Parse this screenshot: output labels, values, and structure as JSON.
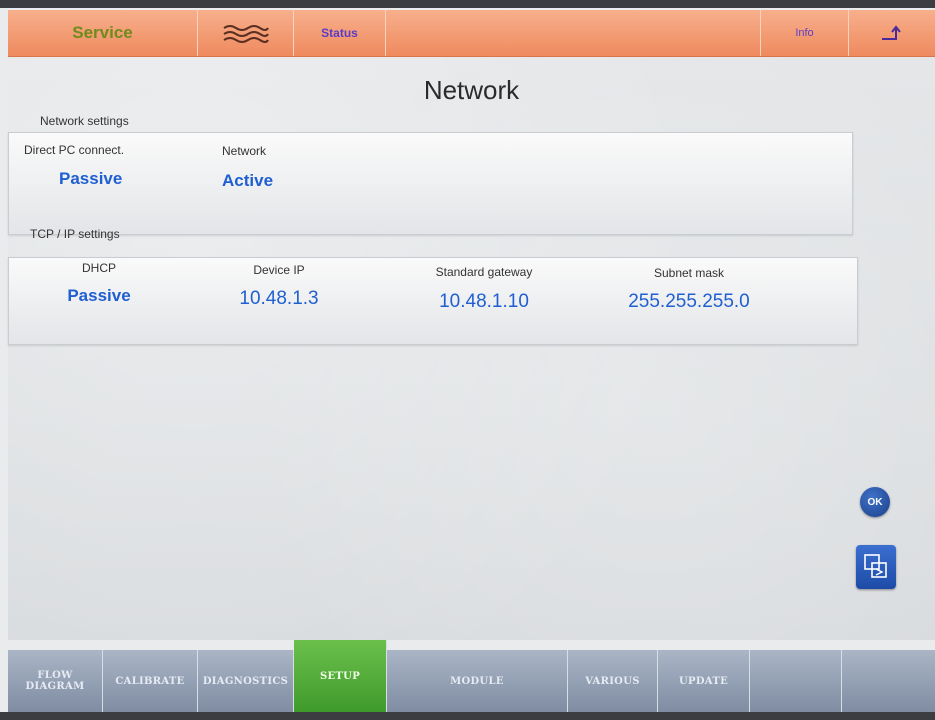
{
  "topbar": {
    "service": "Service",
    "status": "Status",
    "info": "Info"
  },
  "page": {
    "title": "Network"
  },
  "network_settings": {
    "label": "Network settings",
    "direct_pc": {
      "header": "Direct PC connect.",
      "value": "Passive"
    },
    "network": {
      "header": "Network",
      "value": "Active"
    }
  },
  "tcp_ip": {
    "label": "TCP / IP settings",
    "dhcp": {
      "header": "DHCP",
      "value": "Passive"
    },
    "device_ip": {
      "header": "Device IP",
      "value": "10.48.1.3"
    },
    "gateway": {
      "header": "Standard gateway",
      "value": "10.48.1.10"
    },
    "subnet": {
      "header": "Subnet mask",
      "value": "255.255.255.0"
    }
  },
  "buttons": {
    "ok": "OK"
  },
  "bottom_tabs": [
    {
      "label": "FLOW DIAGRAM"
    },
    {
      "label": "CALIBRATE"
    },
    {
      "label": "DIAGNOSTICS"
    },
    {
      "label": "SETUP",
      "active": true
    },
    {
      "label": "MODULE"
    },
    {
      "label": "VARIOUS"
    },
    {
      "label": "UPDATE"
    },
    {
      "label": ""
    },
    {
      "label": ""
    }
  ],
  "colors": {
    "topbar": "#ef8a5f",
    "value_blue": "#1f5fd1",
    "active_tab": "#4fae36",
    "tab_bar": "#8a97ab"
  }
}
